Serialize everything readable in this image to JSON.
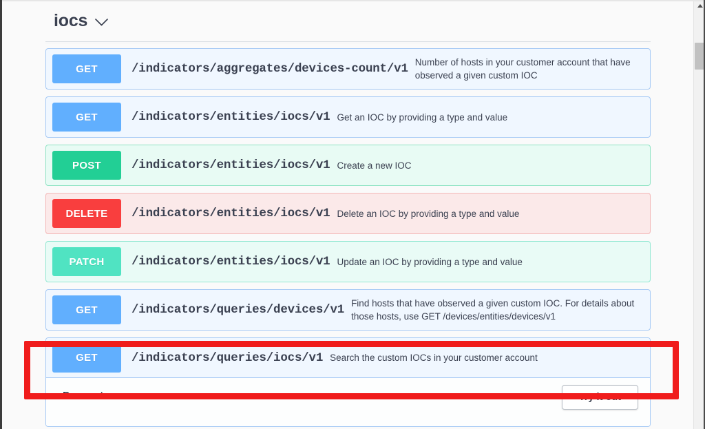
{
  "window": {
    "scrollbar": {
      "up_arrow_icon": "triangle-up-icon",
      "thumb_label": "scrollbar-thumb"
    }
  },
  "tag": {
    "title": "iocs",
    "toggle_icon": "chevron-down-icon"
  },
  "operations": [
    {
      "method": "GET",
      "method_class": "get",
      "path": "/indicators/aggregates/devices-count/v1",
      "description": "Number of hosts in your customer account that have observed a given custom IOC",
      "expanded": false
    },
    {
      "method": "GET",
      "method_class": "get",
      "path": "/indicators/entities/iocs/v1",
      "description": "Get an IOC by providing a type and value",
      "expanded": false
    },
    {
      "method": "POST",
      "method_class": "post",
      "path": "/indicators/entities/iocs/v1",
      "description": "Create a new IOC",
      "expanded": false
    },
    {
      "method": "DELETE",
      "method_class": "delete",
      "path": "/indicators/entities/iocs/v1",
      "description": "Delete an IOC by providing a type and value",
      "expanded": false
    },
    {
      "method": "PATCH",
      "method_class": "patch",
      "path": "/indicators/entities/iocs/v1",
      "description": "Update an IOC by providing a type and value",
      "expanded": false
    },
    {
      "method": "GET",
      "method_class": "get",
      "path": "/indicators/queries/devices/v1",
      "description": "Find hosts that have observed a given custom IOC. For details about those hosts, use GET /devices/entities/devices/v1",
      "expanded": false
    }
  ],
  "expanded_operation": {
    "method": "GET",
    "method_class": "get",
    "path": "/indicators/queries/iocs/v1",
    "description": "Search the custom IOCs in your customer account",
    "parameters_label": "Parameters",
    "try_it_out_label": "Try it out"
  },
  "annotation": {
    "type": "red-highlight-rectangle",
    "color": "#f01c1c",
    "target": "/indicators/queries/iocs/v1"
  },
  "colors": {
    "get": "#61affe",
    "post": "#22cf95",
    "delete": "#f93e3e",
    "patch": "#50e3c2",
    "highlight": "#f01c1c",
    "text": "#3b4151",
    "page_background": "#fafafa"
  }
}
